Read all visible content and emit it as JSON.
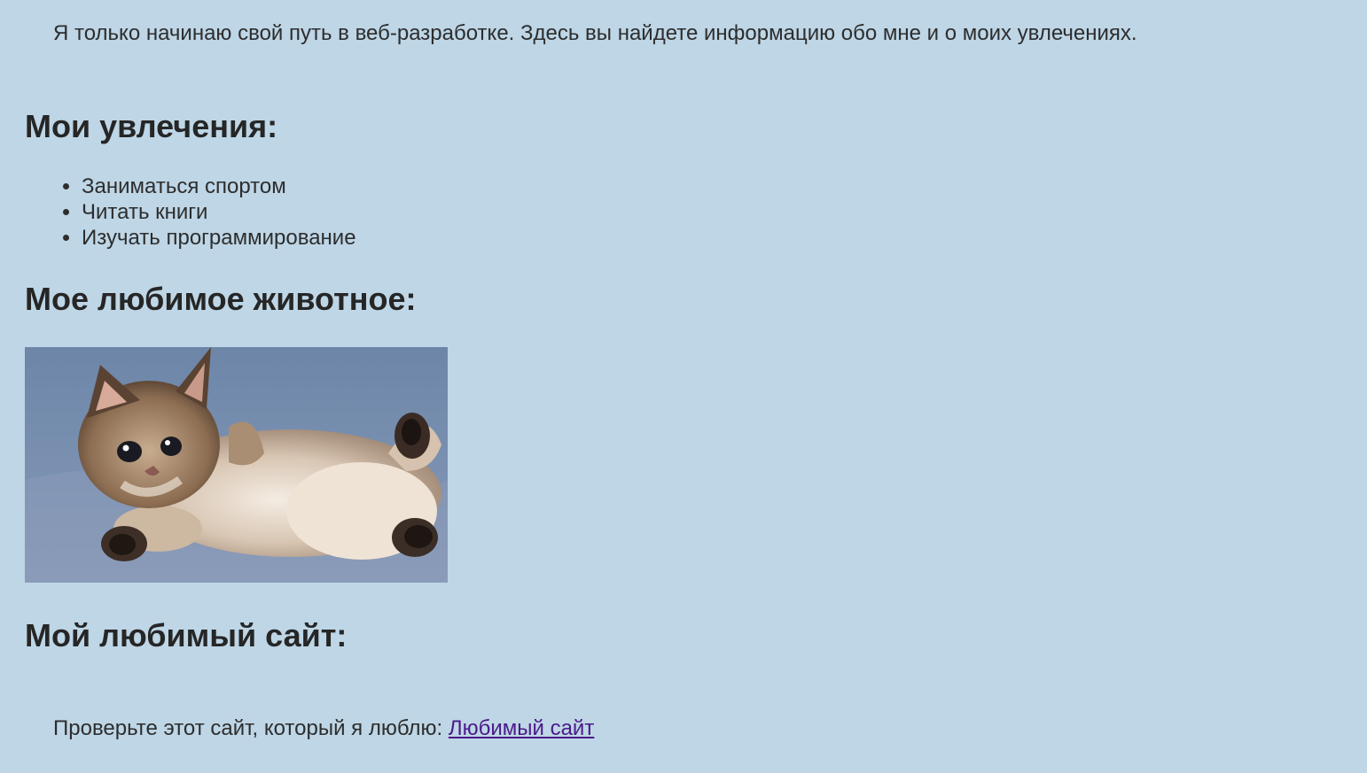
{
  "intro_text": "Я только начинаю свой путь в веб-разработке. Здесь вы найдете информацию обо мне и о моих увлечениях.",
  "hobbies": {
    "heading": "Мои увлечения:",
    "items": [
      "Заниматься спортом",
      "Читать книги",
      "Изучать программирование"
    ]
  },
  "animal": {
    "heading": "Мое любимое животное:",
    "image_alt": "Котенок"
  },
  "site": {
    "heading": "Мой любимый сайт:",
    "text": "Проверьте этот сайт, который я люблю: ",
    "link_label": "Любимый сайт"
  },
  "colors": {
    "background": "#bed6e6",
    "text": "#2d2d2d",
    "link_visited": "#4b1a8a"
  }
}
